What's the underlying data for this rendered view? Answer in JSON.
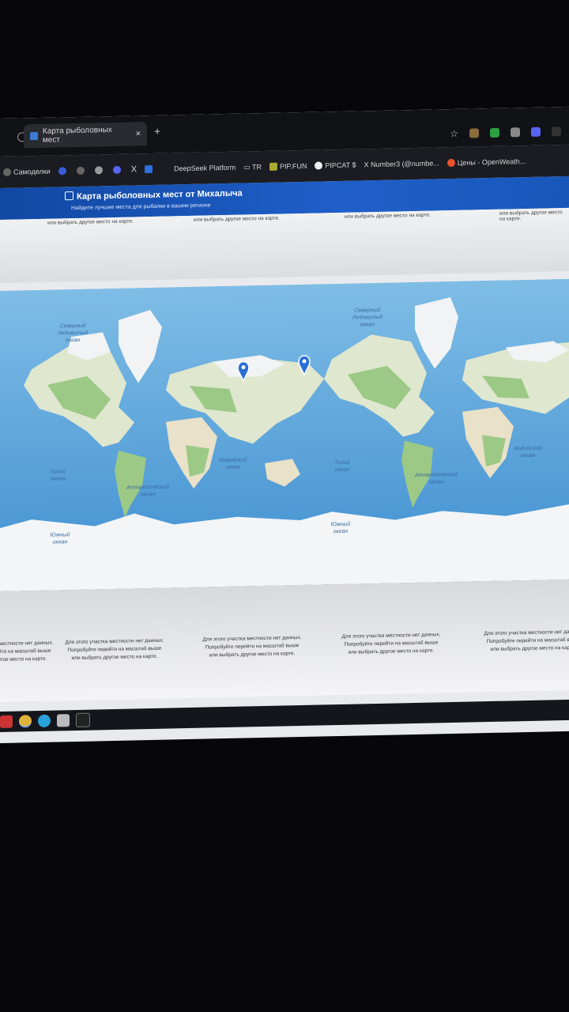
{
  "browser": {
    "tab_title": "Карта рыболовных мест",
    "tab_close": "×",
    "new_tab": "+",
    "bookmarks": [
      {
        "label": "Самоделки"
      },
      {
        "label": "DeepSeek Platform"
      },
      {
        "label": "TR"
      },
      {
        "label": "PIP.FUN"
      },
      {
        "label": "PIPCAT $"
      },
      {
        "label": "Number3 (@numbe..."
      },
      {
        "label": "Цены - OpenWeath..."
      }
    ]
  },
  "site": {
    "title": "Карта рыболовных мест от Михалыча",
    "subtitle": "Найдите лучшие места для рыбалки в вашем регионе"
  },
  "notices": {
    "top_line": "или выбрать другое место на карте.",
    "bottom_lines": [
      "Для этого участка местности нет данных.",
      "Попробуйте перейти на масштаб выше",
      "или выбрать другое место на карте."
    ]
  },
  "map": {
    "ocean_labels": {
      "arctic": [
        "Северный",
        "Ледовитый",
        "океан"
      ],
      "indian": [
        "Индийский",
        "океан"
      ],
      "pacific": [
        "Тихий",
        "океан"
      ],
      "atlantic": [
        "Атлантический",
        "океан"
      ],
      "southern": [
        "Южный",
        "океан"
      ]
    },
    "marker_count": 2
  },
  "colors": {
    "ocean": "#5da6dc",
    "land": "#dfe7cf",
    "forest": "#8fc27a",
    "ice": "#f3f5f7",
    "header": "#1a55b8",
    "marker": "#2a6fd6"
  }
}
